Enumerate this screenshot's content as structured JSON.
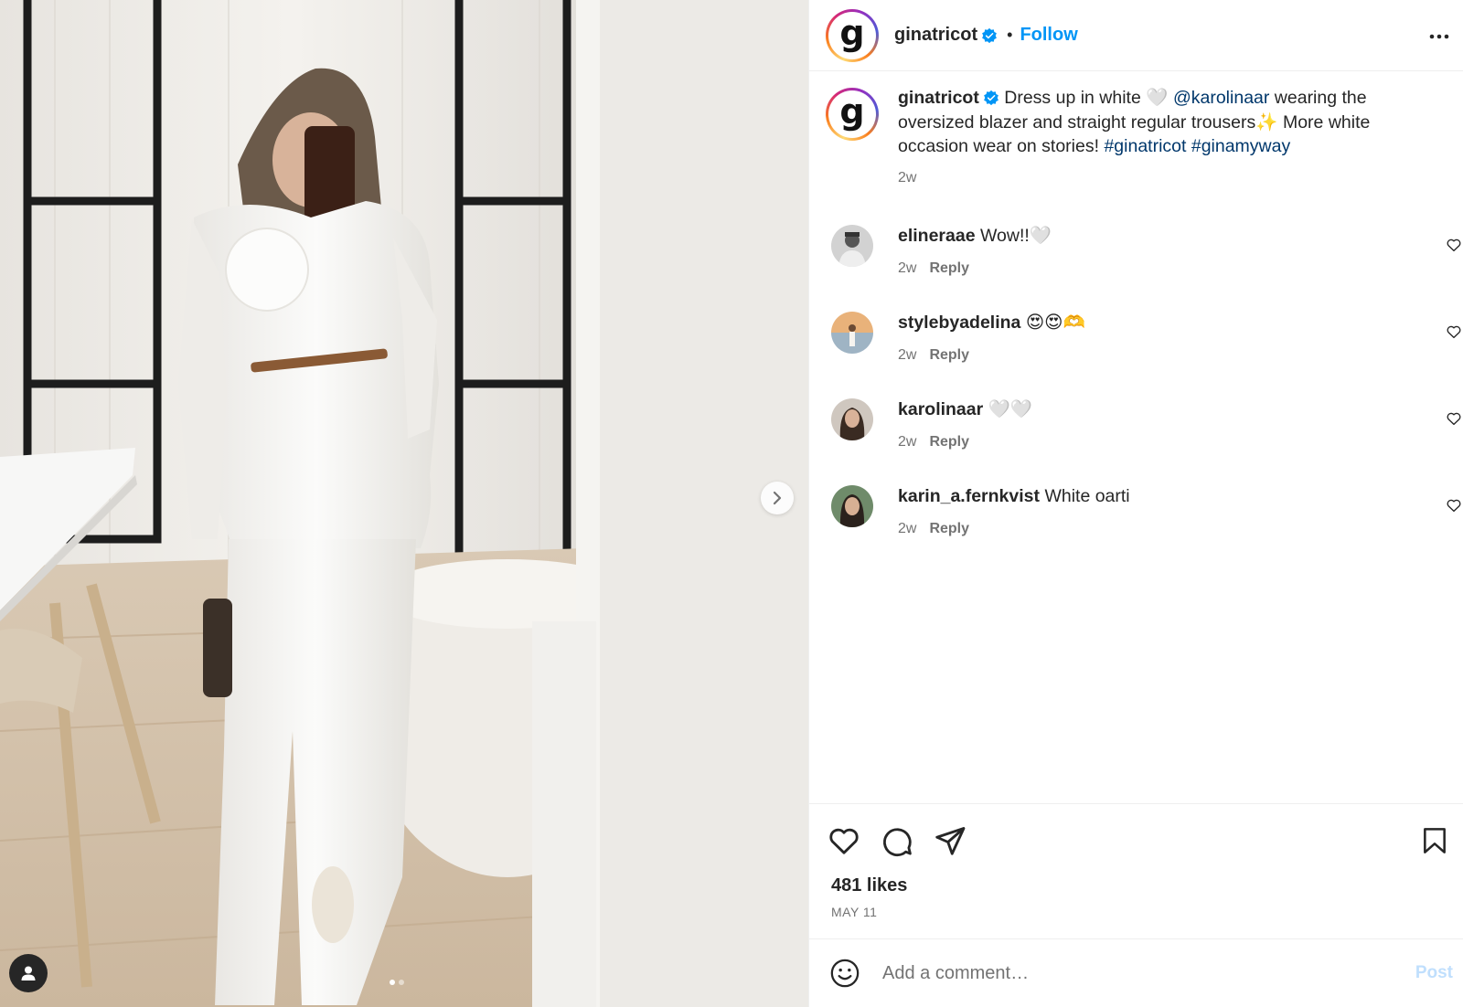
{
  "colors": {
    "accent_blue": "#0095f6",
    "link_blue": "#00376b",
    "text": "#262626",
    "secondary": "#737373",
    "post_disabled": "#c0dffd"
  },
  "photo": {
    "icons": {
      "next": "chevron-right-icon",
      "tags": "user-icon"
    },
    "carousel_count": 2,
    "carousel_active": 0
  },
  "header": {
    "username": "ginatricot",
    "avatar_letter": "g",
    "separator": "•",
    "follow_label": "Follow",
    "icons": {
      "verified": "verified-badge-icon",
      "more": "more-options-icon"
    }
  },
  "caption": {
    "username": "ginatricot",
    "avatar_letter": "g",
    "text_1": " Dress up in white 🤍 ",
    "mention": "@karolinaar",
    "text_2": " wearing the oversized blazer and straight regular trousers✨ More white occasion wear on stories! ",
    "hashtag_1": "#ginatricot",
    "space": " ",
    "hashtag_2": "#ginamyway",
    "time": "2w"
  },
  "comments": [
    {
      "username": "elineraae",
      "text": "Wow!!🤍",
      "time": "2w",
      "reply": "Reply"
    },
    {
      "username": "stylebyadelina",
      "text": "😍😍🫶",
      "time": "2w",
      "reply": "Reply"
    },
    {
      "username": "karolinaar",
      "text": "🤍🤍",
      "time": "2w",
      "reply": "Reply"
    },
    {
      "username": "karin_a.fernkvist",
      "text": "White oarti",
      "time": "2w",
      "reply": "Reply"
    }
  ],
  "actions": {
    "likes": "481 likes",
    "date": "MAY 11",
    "icons": [
      "heart-icon",
      "comment-icon",
      "share-icon",
      "bookmark-icon"
    ]
  },
  "add_comment": {
    "placeholder": "Add a comment…",
    "post_label": "Post",
    "icon": "emoji-icon"
  }
}
